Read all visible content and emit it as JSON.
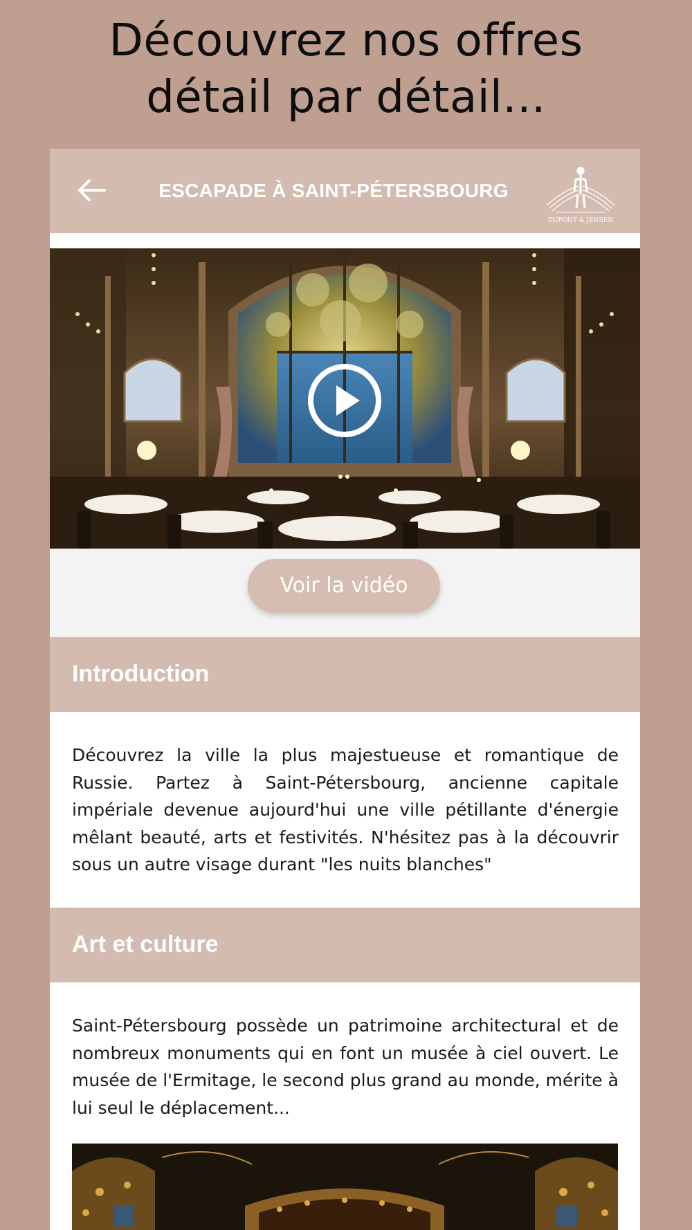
{
  "headline": {
    "line1": "Découvrez nos offres",
    "line2": "détail par détail..."
  },
  "topbar": {
    "title": "ESCAPADE À SAINT-PÉTERSBOURG",
    "back_icon": "arrow-left-icon",
    "logo_text": "DUPONT & JENSEN"
  },
  "video": {
    "play_icon": "play-icon",
    "button_label": "Voir la vidéo"
  },
  "sections": [
    {
      "title": "Introduction",
      "body": "Découvrez la ville la plus majestueuse et romantique de Russie. Partez à Saint-Pétersbourg, ancienne capitale impériale devenue aujourd'hui une ville pétillante d'énergie mêlant beauté, arts et festivités. N'hésitez pas à la découvrir sous un autre visage durant \"les nuits blanches\""
    },
    {
      "title": "Art et culture",
      "body": "Saint-Pétersbourg possède un patrimoine architectural et de nombreux monuments qui en font un musée à ciel ouvert. Le musée de l'Ermitage, le second plus grand au monde, mérite à lui seul le déplacement..."
    }
  ],
  "colors": {
    "background": "#bf9f8f",
    "accent": "#d4bbaf",
    "text": "#1a1a1a"
  }
}
